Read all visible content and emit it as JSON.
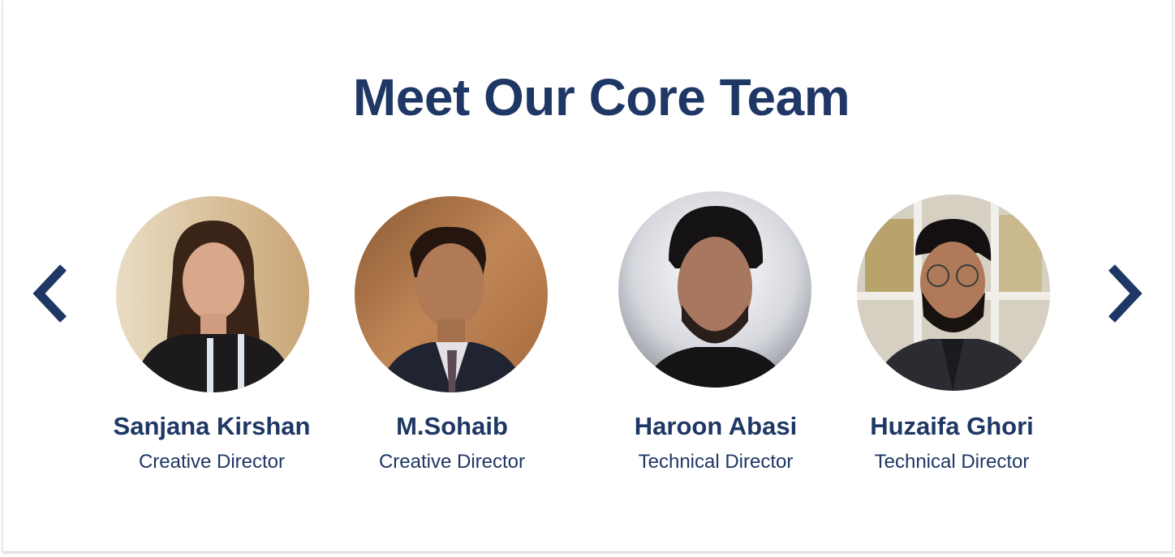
{
  "section": {
    "title": "Meet Our Core Team"
  },
  "carousel": {
    "prev_icon": "chevron-left-icon",
    "next_icon": "chevron-right-icon",
    "accent_color": "#1e3764",
    "members": [
      {
        "name": "Sanjana Kirshan",
        "role": "Creative Director",
        "photo": "avatar-photo"
      },
      {
        "name": "M.Sohaib",
        "role": "Creative Director",
        "photo": "avatar-photo"
      },
      {
        "name": "Haroon Abasi",
        "role": "Technical Director",
        "photo": "avatar-photo"
      },
      {
        "name": "Huzaifa Ghori",
        "role": "Technical Director",
        "photo": "avatar-photo"
      }
    ]
  }
}
